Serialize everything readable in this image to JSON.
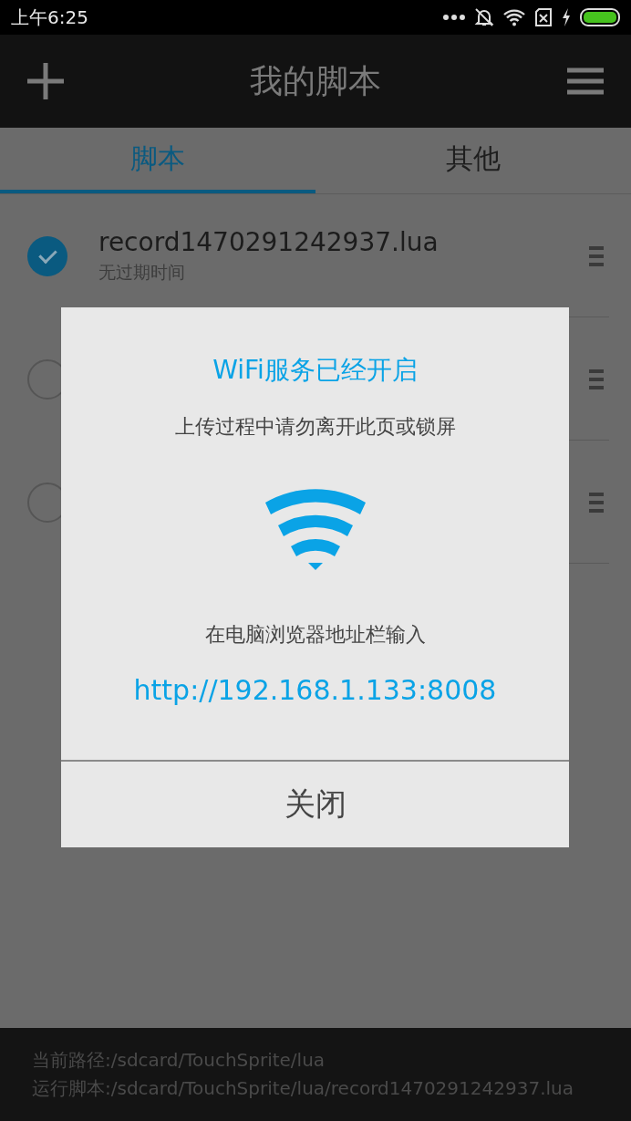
{
  "status_bar": {
    "time": "上午6:25"
  },
  "app_bar": {
    "title": "我的脚本"
  },
  "tabs": [
    {
      "label": "脚本",
      "selected": true
    },
    {
      "label": "其他",
      "selected": false
    }
  ],
  "scripts": [
    {
      "name": "record1470291242937.lua",
      "expiry": "无过期时间",
      "selected": true
    },
    {
      "selected": false
    },
    {
      "selected": false
    }
  ],
  "dialog": {
    "title": "WiFi服务已经开启",
    "message": "上传过程中请勿离开此页或锁屏",
    "instruction": "在电脑浏览器地址栏输入",
    "url": "http://192.168.1.133:8008",
    "button": "关闭"
  },
  "footer": {
    "path": "当前路径:/sdcard/TouchSprite/lua",
    "running": "运行脚本:/sdcard/TouchSprite/lua/record1470291242937.lua"
  }
}
